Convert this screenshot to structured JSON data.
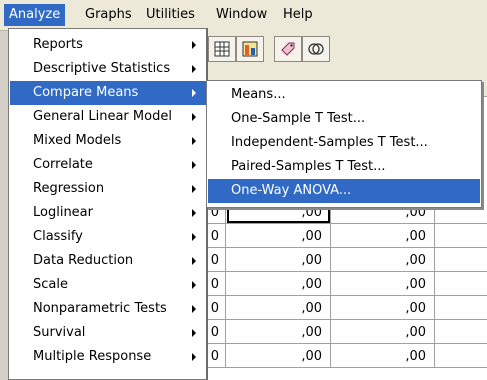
{
  "menubar": {
    "items": [
      {
        "label": "Analyze",
        "active": true
      },
      {
        "label": "Graphs"
      },
      {
        "label": "Utilities"
      },
      {
        "label": "Window"
      },
      {
        "label": "Help"
      }
    ]
  },
  "analyze_menu": {
    "items": [
      {
        "label": "Reports",
        "submenu": true
      },
      {
        "label": "Descriptive Statistics",
        "submenu": true
      },
      {
        "label": "Compare Means",
        "submenu": true,
        "active": true
      },
      {
        "label": "General Linear Model",
        "submenu": true
      },
      {
        "label": "Mixed Models",
        "submenu": true
      },
      {
        "label": "Correlate",
        "submenu": true
      },
      {
        "label": "Regression",
        "submenu": true
      },
      {
        "label": "Loglinear",
        "submenu": true
      },
      {
        "label": "Classify",
        "submenu": true
      },
      {
        "label": "Data Reduction",
        "submenu": true
      },
      {
        "label": "Scale",
        "submenu": true
      },
      {
        "label": "Nonparametric Tests",
        "submenu": true
      },
      {
        "label": "Survival",
        "submenu": true
      },
      {
        "label": "Multiple Response",
        "submenu": true
      }
    ]
  },
  "compare_means_submenu": {
    "items": [
      {
        "label": "Means..."
      },
      {
        "label": "One-Sample T Test..."
      },
      {
        "label": "Independent-Samples T Test..."
      },
      {
        "label": "Paired-Samples T Test..."
      },
      {
        "label": "One-Way ANOVA...",
        "active": true
      }
    ]
  },
  "toolbar": {
    "icons": [
      "grid-table-icon",
      "weight-cases-icon",
      "value-labels-icon"
    ]
  },
  "grid": {
    "rows": [
      {
        "c0": "0",
        "c1": ",00",
        "c2": ",00",
        "c3": ""
      },
      {
        "c0": "0",
        "c1": ",00",
        "c2": ",00",
        "c3": ""
      },
      {
        "c0": "0",
        "c1": ",00",
        "c2": ",00",
        "c3": ""
      },
      {
        "c0": "0",
        "c1": ",00",
        "c2": ",00",
        "c3": ""
      },
      {
        "c0": "0",
        "c1": ",00",
        "c2": ",00",
        "c3": ""
      },
      {
        "c0": "0",
        "c1": ",00",
        "c2": ",00",
        "c3": ""
      },
      {
        "c0": "0",
        "c1": ",00",
        "c2": ",00",
        "c3": ""
      }
    ]
  },
  "colors": {
    "highlight": "#316ac5",
    "menubar_bg": "#ece9d8",
    "menu_bg": "#ffffff"
  }
}
